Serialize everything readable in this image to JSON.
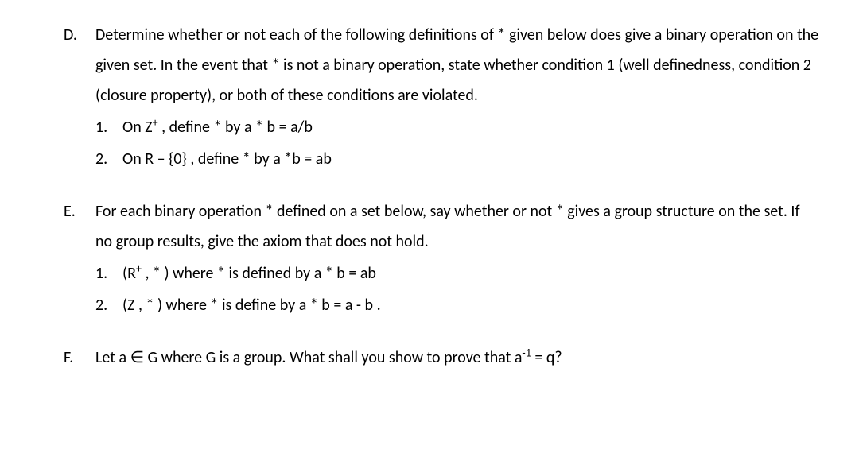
{
  "problems": {
    "D": {
      "marker": "D.",
      "intro": "Determine whether or not each of the following definitions of * given below does give a binary operation on the given set. In the event that * is not a binary operation, state whether condition 1 (well definedness, condition 2 (closure property), or both of these conditions are violated.",
      "items": {
        "i1": {
          "marker": "1.",
          "text_before": "On Z",
          "sup": "+",
          "text_after": " , define * by a * b = a/b"
        },
        "i2": {
          "marker": "2.",
          "text": "On R – {0} , define * by a *b = ab"
        }
      }
    },
    "E": {
      "marker": "E.",
      "intro": "For each binary operation * defined on a set below, say whether or not * gives a group structure on the set. If no group results, give the axiom that does not hold.",
      "items": {
        "i1": {
          "marker": "1.",
          "text_before": "(R",
          "sup": "+",
          "text_after": " , * ) where * is defined by a * b = ab"
        },
        "i2": {
          "marker": "2.",
          "text": "(Z , * ) where * is define by a * b = a - b ."
        }
      }
    },
    "F": {
      "marker": "F.",
      "text_before": "Let a ",
      "elem_sym": "∈",
      "text_mid": " G where G is a group. What shall you show to prove that a",
      "sup": "-1",
      "text_after": " = q?"
    }
  }
}
